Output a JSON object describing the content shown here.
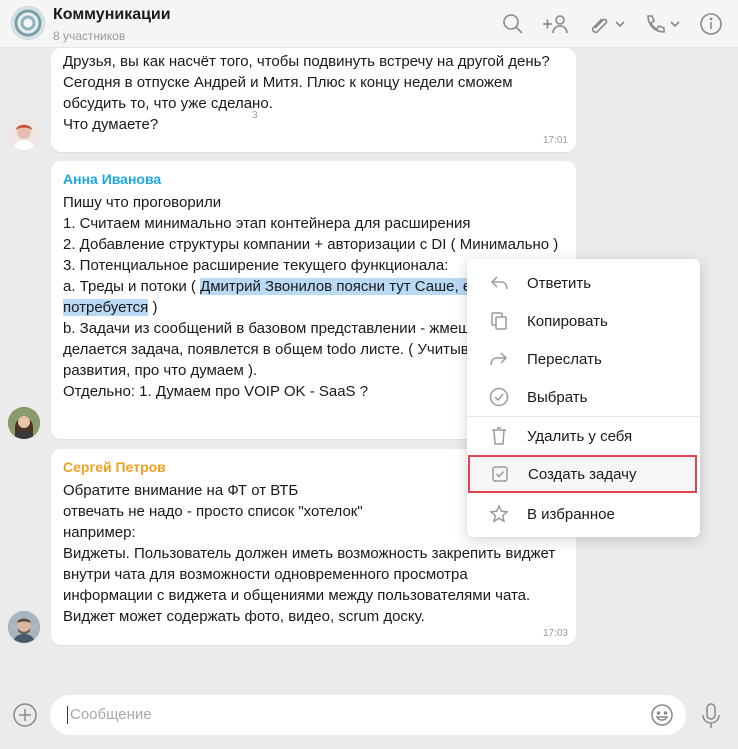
{
  "header": {
    "title": "Коммуникации",
    "subtitle": "8 участников"
  },
  "messages": [
    {
      "lines": [
        "Друзья, вы как насчёт того, чтобы подвинуть встречу на другой день?",
        "Сегодня в отпуске Андрей и Митя. Плюс к концу недели сможем",
        "обсудить то, что уже сделано.",
        "Что думаете?"
      ],
      "read_count": "3",
      "time": "17:01"
    },
    {
      "author": "Анна Иванова",
      "author_color": "#1fa8e0",
      "lines": [
        "Пишу что проговорили",
        "1. Считаем минимально этап контейнера для расширения",
        "2. Добавление структуры компании + авторизации с DI ( Минимально )",
        "3. Потенциальное расширение текущего функционала:",
        "a. Треды и потоки ( ",
        "Дмитрий Звонилов поясни тут Саше, ес",
        "потребуется",
        " )",
        "b. Задачи из сообщений в базовом представлении - жмещ",
        "делается задача, появлется в общем todo листе. ( Учитыва",
        "развития, про что думаем ).",
        "Отдельно: 1. Думаем про VOIP OK - SaaS ?"
      ]
    },
    {
      "author": "Сергей Петров",
      "author_color": "#f0a020",
      "lines": [
        "Обратите внимание на ФТ от ВТБ",
        "отвечать не надо - просто список \"хотелок\"",
        "например:",
        "Виджеты. Пользователь должен иметь возможность закрепить виджет",
        "внутри чата для возможности одновременного просмотра",
        "информации с виджета и общениями между пользователями чата.",
        "Виджет может содержать фото, видео, scrum доску."
      ],
      "time": "17:03"
    }
  ],
  "context_menu": {
    "items": [
      {
        "label": "Ответить",
        "icon": "reply-icon"
      },
      {
        "label": "Копировать",
        "icon": "copy-icon"
      },
      {
        "label": "Переслать",
        "icon": "forward-icon"
      },
      {
        "label": "Выбрать",
        "icon": "check-circle-icon"
      },
      {
        "label": "Удалить у себя",
        "icon": "trash-icon"
      },
      {
        "label": "Создать задачу",
        "icon": "task-checkbox-icon"
      },
      {
        "label": "В избранное",
        "icon": "star-icon"
      }
    ],
    "highlight_color": "#e0454f"
  },
  "composer": {
    "placeholder": "Сообщение"
  }
}
